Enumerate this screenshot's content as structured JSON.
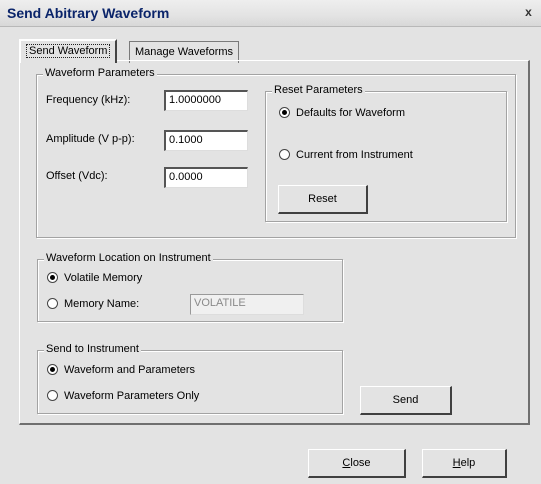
{
  "window": {
    "title": "Send Abitrary Waveform",
    "close_glyph": "x"
  },
  "tabs": [
    {
      "label": "Send Waveform",
      "selected": true
    },
    {
      "label": "Manage Waveforms",
      "selected": false
    }
  ],
  "waveform_parameters": {
    "legend": "Waveform Parameters",
    "frequency": {
      "label": "Frequency (kHz):",
      "value": "1.0000000"
    },
    "amplitude": {
      "label": "Amplitude (V p-p):",
      "value": "0.1000"
    },
    "offset": {
      "label": "Offset (Vdc):",
      "value": "0.0000"
    }
  },
  "reset_parameters": {
    "legend": "Reset Parameters",
    "options": [
      {
        "label": "Defaults for Waveform",
        "checked": true
      },
      {
        "label": "Current from Instrument",
        "checked": false
      }
    ],
    "reset_label": "Reset"
  },
  "waveform_location": {
    "legend": "Waveform Location on Instrument",
    "volatile": {
      "label": "Volatile Memory",
      "checked": true
    },
    "memory_name": {
      "label": "Memory Name:",
      "checked": false,
      "value": "VOLATILE"
    }
  },
  "send_to_instrument": {
    "legend": "Send to Instrument",
    "options": [
      {
        "label": "Waveform and Parameters",
        "checked": true
      },
      {
        "label": "Waveform Parameters Only",
        "checked": false
      }
    ]
  },
  "buttons": {
    "send": "Send",
    "close_first": "C",
    "close_rest": "lose",
    "help_first": "H",
    "help_rest": "elp"
  }
}
